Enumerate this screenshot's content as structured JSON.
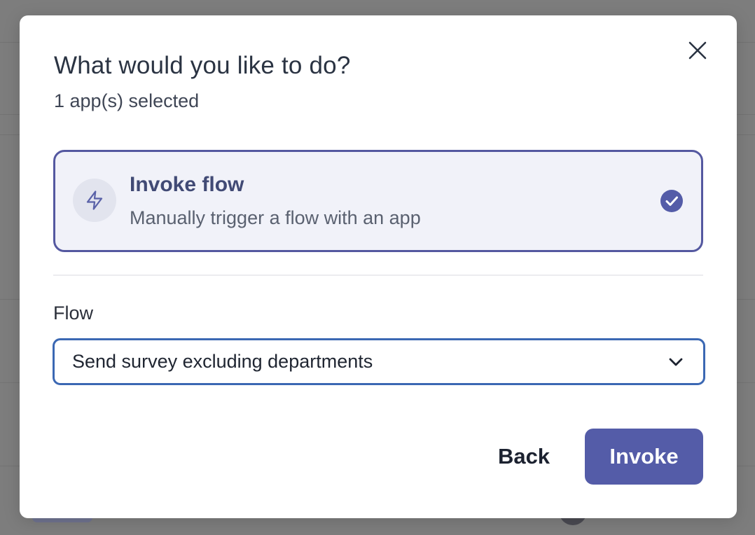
{
  "modal": {
    "title": "What would you like to do?",
    "subtitle": "1 app(s) selected",
    "close_icon": "close-icon"
  },
  "option": {
    "icon": "lightning-bolt-icon",
    "title": "Invoke flow",
    "description": "Manually trigger a flow with an app",
    "selected": true,
    "selected_icon": "check-circle-icon"
  },
  "flow_field": {
    "label": "Flow",
    "selected_value": "Send survey excluding departments",
    "dropdown_icon": "chevron-down-icon"
  },
  "actions": {
    "back_label": "Back",
    "invoke_label": "Invoke"
  },
  "colors": {
    "accent": "#545ca8",
    "selected_border": "#5458a0",
    "selected_bg": "#f1f2f9",
    "focus_border": "#3b68b3",
    "overlay": "#7d7d7d"
  }
}
